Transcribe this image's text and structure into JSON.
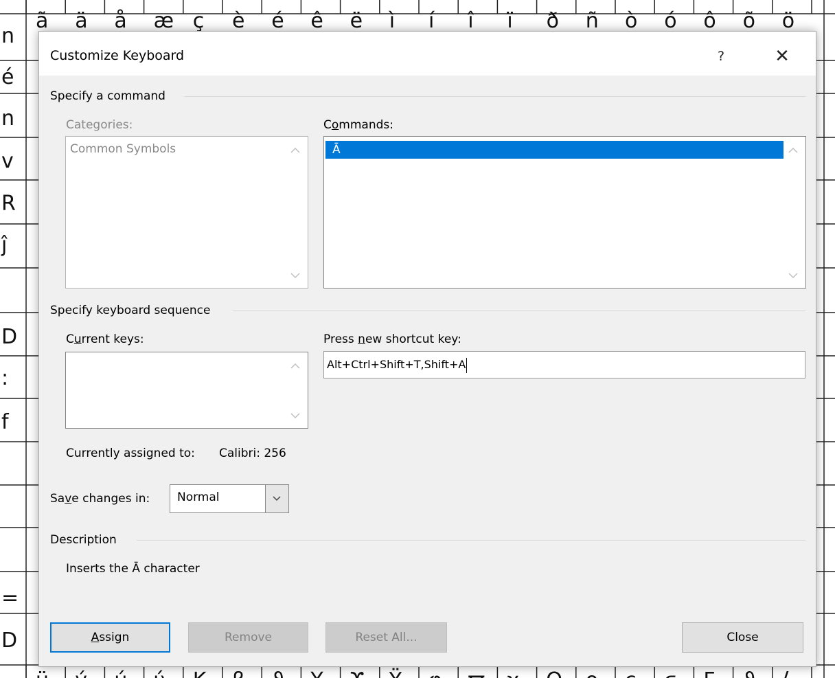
{
  "background_symbols": {
    "top_row": [
      "ã",
      "ä",
      "å",
      "æ",
      "ç",
      "è",
      "é",
      "ê",
      "ë",
      "ì",
      "í",
      "î",
      "ï",
      "ð",
      "ñ",
      "ò",
      "ó",
      "ô",
      "õ",
      "ö"
    ],
    "bottom_row": [
      "ü",
      "ý",
      "ú",
      "ύ",
      "Κ",
      "β",
      "ϑ",
      "Υ",
      "ϒ",
      "Ϋ",
      "φ",
      "ϖ",
      "χ",
      "Ω",
      "ο",
      "ς",
      "ϛ",
      "Ϝ",
      "ϑ",
      "ϟ"
    ],
    "left_col": [
      "n",
      "é",
      "n",
      "v",
      "R",
      "ĵ",
      "D",
      ":",
      "f",
      "",
      "",
      "",
      "=",
      "D"
    ]
  },
  "dialog": {
    "title": "Customize Keyboard",
    "help_label": "?",
    "close_label": "✕",
    "specify_command": {
      "heading": "Specify a command",
      "categories_label": "Categories:",
      "categories_items": [
        "Common Symbols"
      ],
      "commands_label_pre": "C",
      "commands_label_ul": "o",
      "commands_label_post": "mmands:",
      "commands_items": [
        "Ā"
      ]
    },
    "keyboard_sequence": {
      "heading": "Specify keyboard sequence",
      "current_keys_pre": "C",
      "current_keys_ul": "u",
      "current_keys_post": "rrent keys:",
      "press_new_pre": "Press ",
      "press_new_ul": "n",
      "press_new_post": "ew shortcut key:",
      "new_shortcut_value": "Alt+Ctrl+Shift+T,Shift+A",
      "currently_assigned_label": "Currently assigned to:",
      "currently_assigned_value": "Calibri: 256"
    },
    "save_changes": {
      "label_pre": "Sa",
      "label_ul": "v",
      "label_post": "e changes in:",
      "selected": "Normal"
    },
    "description": {
      "heading": "Description",
      "text": "Inserts the Ā character"
    },
    "buttons": {
      "assign_ul": "A",
      "assign_post": "ssign",
      "remove": "Remove",
      "reset_all": "Reset All...",
      "close": "Close"
    }
  },
  "colors": {
    "accent": "#0078d7",
    "dialog_bg": "#f0f0f0"
  }
}
